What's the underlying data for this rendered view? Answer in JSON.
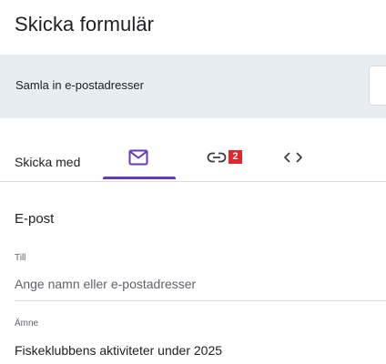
{
  "dialog": {
    "title": "Skicka formulär"
  },
  "collect": {
    "label": "Samla in e-postadresser"
  },
  "send": {
    "label": "Skicka med",
    "tabs": [
      {
        "id": "email",
        "icon": "mail-icon",
        "selected": true
      },
      {
        "id": "link",
        "icon": "link-icon",
        "badge": "2",
        "selected": false
      },
      {
        "id": "embed",
        "icon": "code-icon",
        "selected": false
      }
    ]
  },
  "email_section": {
    "title": "E-post",
    "to": {
      "label": "Till",
      "placeholder": "Ange namn eller e-postadresser",
      "value": ""
    },
    "subject": {
      "label": "Ämne",
      "value": "Fiskeklubbens aktiviteter under 2025"
    }
  },
  "colors": {
    "accent": "#673ab7",
    "badge": "#e4252b",
    "collect_bg": "#e8edf1"
  }
}
